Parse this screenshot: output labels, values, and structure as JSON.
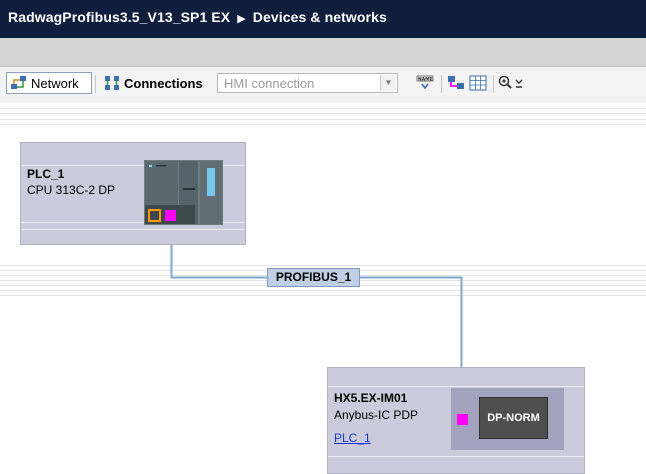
{
  "title": {
    "project": "RadwagProfibus3.5_V13_SP1 EX",
    "separator": "▶",
    "section": "Devices & networks"
  },
  "toolbar": {
    "network_label": "Network",
    "connections_label": "Connections",
    "connection_type_value": "HMI connection",
    "icons": [
      "network-icon",
      "connections-icon",
      "dropdown-arrow-icon",
      "names-icon",
      "highlight-icon",
      "grid-icon",
      "zoom-icon"
    ]
  },
  "devices": {
    "plc": {
      "name": "PLC_1",
      "type": "CPU 313C-2 DP"
    },
    "hx5": {
      "name": "HX5.EX-IM01",
      "type": "Anybus-IC PDP",
      "master_link": "PLC_1",
      "module_label": "DP-NORM"
    }
  },
  "network": {
    "bus_name": "PROFIBUS_1",
    "bus_color": "#7fa8cc"
  },
  "colors": {
    "title_background": "#0f1e3c",
    "device_box": "#cbcbdb",
    "port_pink": "#ff00ff",
    "port_orange": "#ff9a00"
  }
}
